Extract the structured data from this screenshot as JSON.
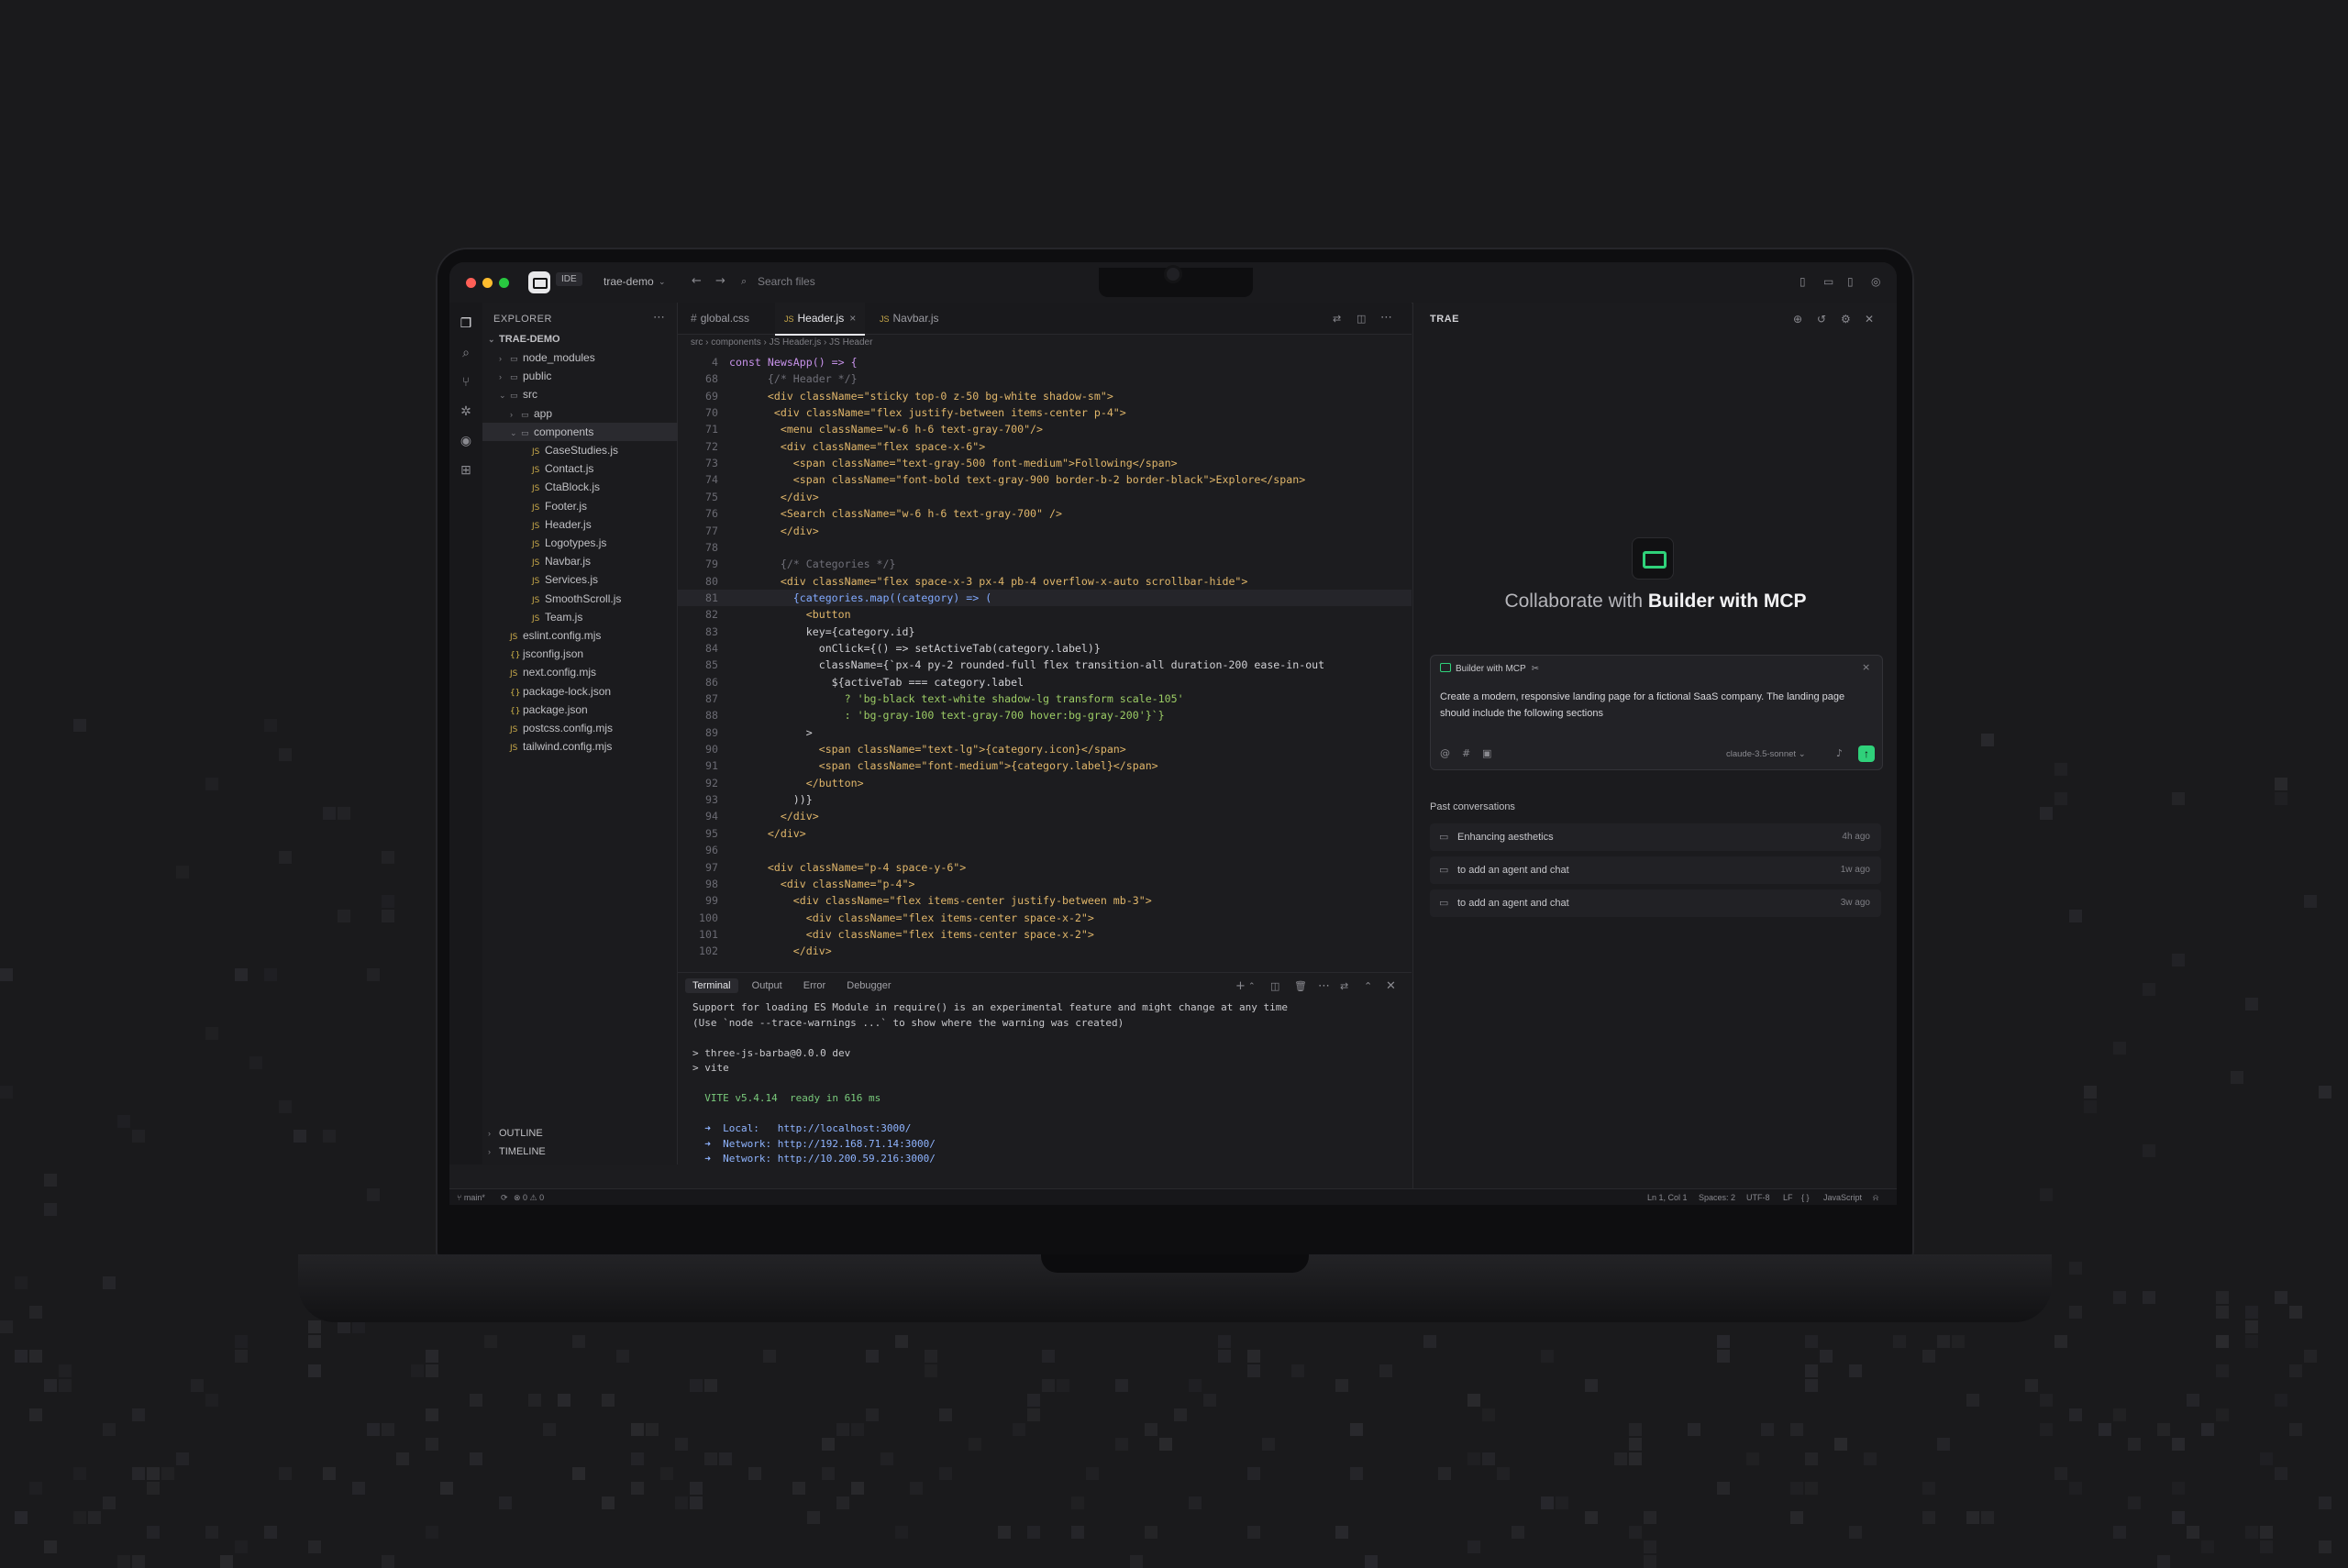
{
  "titlebar": {
    "mode": "IDE",
    "project": "trae-demo",
    "search_placeholder": "Search files"
  },
  "explorer": {
    "title": "EXPLORER",
    "root": "TRAE-DEMO",
    "items": [
      {
        "label": "node_modules",
        "kind": "folder",
        "depth": 1,
        "open": false
      },
      {
        "label": "public",
        "kind": "folder",
        "depth": 1,
        "open": false
      },
      {
        "label": "src",
        "kind": "folder",
        "depth": 1,
        "open": true
      },
      {
        "label": "app",
        "kind": "folder",
        "depth": 2,
        "open": false
      },
      {
        "label": "components",
        "kind": "folder",
        "depth": 2,
        "open": true,
        "selected": true
      },
      {
        "label": "CaseStudies.js",
        "kind": "js",
        "depth": 3
      },
      {
        "label": "Contact.js",
        "kind": "js",
        "depth": 3
      },
      {
        "label": "CtaBlock.js",
        "kind": "js",
        "depth": 3
      },
      {
        "label": "Footer.js",
        "kind": "js",
        "depth": 3
      },
      {
        "label": "Header.js",
        "kind": "js",
        "depth": 3
      },
      {
        "label": "Logotypes.js",
        "kind": "js",
        "depth": 3
      },
      {
        "label": "Navbar.js",
        "kind": "js",
        "depth": 3
      },
      {
        "label": "Services.js",
        "kind": "js",
        "depth": 3
      },
      {
        "label": "SmoothScroll.js",
        "kind": "js",
        "depth": 3
      },
      {
        "label": "Team.js",
        "kind": "js",
        "depth": 3
      },
      {
        "label": "eslint.config.mjs",
        "kind": "js",
        "depth": 1
      },
      {
        "label": "jsconfig.json",
        "kind": "json",
        "depth": 1
      },
      {
        "label": "next.config.mjs",
        "kind": "js",
        "depth": 1
      },
      {
        "label": "package-lock.json",
        "kind": "json",
        "depth": 1
      },
      {
        "label": "package.json",
        "kind": "json",
        "depth": 1
      },
      {
        "label": "postcss.config.mjs",
        "kind": "js",
        "depth": 1
      },
      {
        "label": "tailwind.config.mjs",
        "kind": "js",
        "depth": 1
      }
    ],
    "outline": "OUTLINE",
    "timeline": "TIMELINE"
  },
  "editor": {
    "tabs": [
      {
        "label": "global.css",
        "icon": "#"
      },
      {
        "label": "Header.js",
        "icon": "JS",
        "active": true
      },
      {
        "label": "Navbar.js",
        "icon": "JS"
      }
    ],
    "breadcrumb": "src › components › JS Header.js › JS Header",
    "code": [
      {
        "n": "4",
        "t": "const NewsApp() => {"
      },
      {
        "n": "68",
        "t": "      {/* Header */}"
      },
      {
        "n": "69",
        "t": "      <div className=\"sticky top-0 z-50 bg-white shadow-sm\">"
      },
      {
        "n": "70",
        "t": "       <div className=\"flex justify-between items-center p-4\">"
      },
      {
        "n": "71",
        "t": "        <menu className=\"w-6 h-6 text-gray-700\"/>"
      },
      {
        "n": "72",
        "t": "        <div className=\"flex space-x-6\">"
      },
      {
        "n": "73",
        "t": "          <span className=\"text-gray-500 font-medium\">Following</span>"
      },
      {
        "n": "74",
        "t": "          <span className=\"font-bold text-gray-900 border-b-2 border-black\">Explore</span>"
      },
      {
        "n": "75",
        "t": "        </div>"
      },
      {
        "n": "76",
        "t": "        <Search className=\"w-6 h-6 text-gray-700\" />"
      },
      {
        "n": "77",
        "t": "        </div>"
      },
      {
        "n": "78",
        "t": ""
      },
      {
        "n": "79",
        "t": "        {/* Categories */}"
      },
      {
        "n": "80",
        "t": "        <div className=\"flex space-x-3 px-4 pb-4 overflow-x-auto scrollbar-hide\">"
      },
      {
        "n": "81",
        "t": "          {categories.map((category) => (",
        "hl": true
      },
      {
        "n": "82",
        "t": "            <button"
      },
      {
        "n": "83",
        "t": "            key={category.id}"
      },
      {
        "n": "84",
        "t": "              onClick={() => setActiveTab(category.label)}"
      },
      {
        "n": "85",
        "t": "              className={`px-4 py-2 rounded-full flex transition-all duration-200 ease-in-out"
      },
      {
        "n": "86",
        "t": "                ${activeTab === category.label"
      },
      {
        "n": "87",
        "t": "                  ? 'bg-black text-white shadow-lg transform scale-105'"
      },
      {
        "n": "88",
        "t": "                  : 'bg-gray-100 text-gray-700 hover:bg-gray-200'}`}"
      },
      {
        "n": "89",
        "t": "            >"
      },
      {
        "n": "90",
        "t": "              <span className=\"text-lg\">{category.icon}</span>"
      },
      {
        "n": "91",
        "t": "              <span className=\"font-medium\">{category.label}</span>"
      },
      {
        "n": "92",
        "t": "            </button>"
      },
      {
        "n": "93",
        "t": "          ))}"
      },
      {
        "n": "94",
        "t": "        </div>"
      },
      {
        "n": "95",
        "t": "      </div>"
      },
      {
        "n": "96",
        "t": ""
      },
      {
        "n": "97",
        "t": "      <div className=\"p-4 space-y-6\">"
      },
      {
        "n": "98",
        "t": "        <div className=\"p-4\">"
      },
      {
        "n": "99",
        "t": "          <div className=\"flex items-center justify-between mb-3\">"
      },
      {
        "n": "100",
        "t": "            <div className=\"flex items-center space-x-2\">"
      },
      {
        "n": "101",
        "t": "            <div className=\"flex items-center space-x-2\">"
      },
      {
        "n": "102",
        "t": "          </div>"
      }
    ]
  },
  "terminal": {
    "tabs": [
      "Terminal",
      "Output",
      "Error",
      "Debugger"
    ],
    "lines": [
      "Support for loading ES Module in require() is an experimental feature and might change at any time",
      "(Use `node --trace-warnings ...` to show where the warning was created)",
      "",
      "> three-js-barba@0.0.0 dev",
      "> vite",
      "",
      "  VITE v5.4.14  ready in 616 ms",
      "",
      "  ➜  Local:   http://localhost:3000/",
      "  ➜  Network: http://192.168.71.14:3000/",
      "  ➜  Network: http://10.200.59.216:3000/"
    ]
  },
  "chat": {
    "title": "TRAE",
    "heading_prefix": "Collaborate with",
    "heading_bold": "Builder with MCP",
    "chip": "Builder with MCP",
    "prompt": "Create a modern, responsive landing page for a fictional SaaS company. The landing page should include the following sections",
    "model": "claude-3.5-sonnet",
    "past_title": "Past conversations",
    "conversations": [
      {
        "title": "Enhancing aesthetics",
        "age": "4h ago"
      },
      {
        "title": "to add an agent and chat",
        "age": "1w ago"
      },
      {
        "title": "to add an agent and chat",
        "age": "3w ago"
      }
    ],
    "accent": "#2fd17a"
  },
  "statusbar": {
    "branch": "main*",
    "problems": "0 ⚠ 0",
    "position": "Ln 1, Col 1",
    "spaces": "Spaces: 2",
    "encoding": "UTF-8",
    "eol": "LF",
    "braces": "{ }",
    "language": "JavaScript"
  }
}
